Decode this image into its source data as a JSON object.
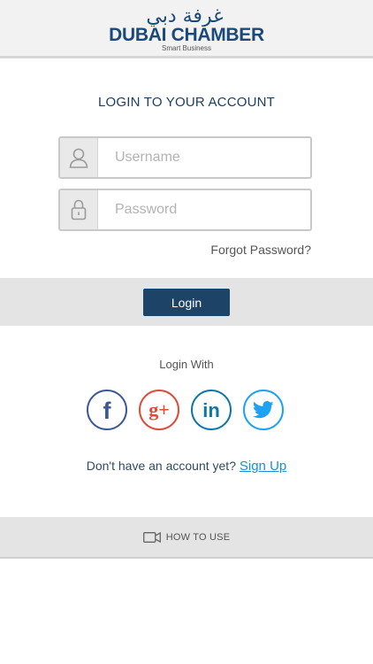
{
  "header": {
    "logo_arabic": "غرفة دبي",
    "logo_main": "DUBAI CHAMBER",
    "logo_sub": "Smart Business"
  },
  "title": "LOGIN TO YOUR ACCOUNT",
  "form": {
    "username_placeholder": "Username",
    "username_value": "",
    "password_placeholder": "Password",
    "password_value": "",
    "forgot_label": "Forgot Password?",
    "login_label": "Login"
  },
  "social": {
    "heading": "Login With",
    "providers": [
      {
        "name": "facebook",
        "glyph": "f",
        "color": "#3b5998"
      },
      {
        "name": "google-plus",
        "glyph": "g+",
        "color": "#dd4b39"
      },
      {
        "name": "linkedin",
        "glyph": "in",
        "color": "#0e76a8"
      },
      {
        "name": "twitter",
        "glyph": "twitter-bird",
        "color": "#1da1f2"
      }
    ]
  },
  "signup": {
    "prompt": "Don't have an account yet?",
    "link": "Sign Up"
  },
  "howto": {
    "label": "HOW TO USE",
    "icon": "video-camera-icon"
  },
  "colors": {
    "brand": "#1b4a7a",
    "button": "#1d4466",
    "link": "#1a8fd8"
  }
}
